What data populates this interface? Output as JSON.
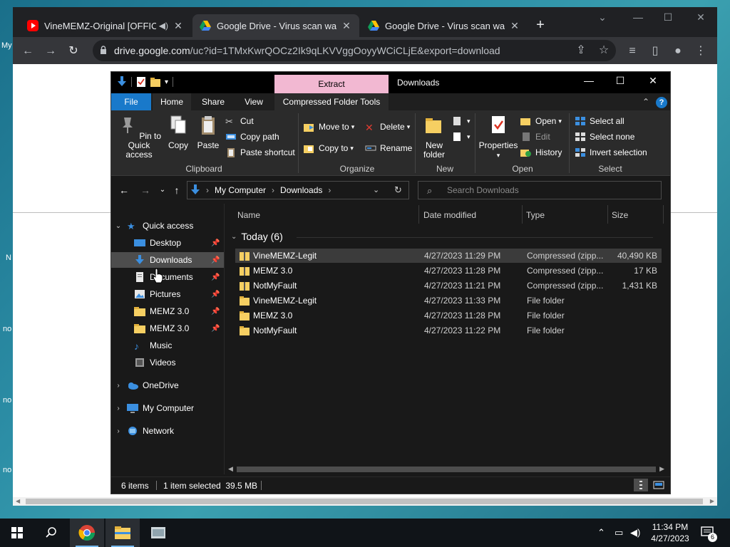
{
  "chrome": {
    "tabs": [
      {
        "title": "VineMEMZ-Original [OFFICIAL",
        "icon": "youtube-icon",
        "audio": true
      },
      {
        "title": "Google Drive - Virus scan warning",
        "icon": "google-drive-icon"
      },
      {
        "title": "Google Drive - Virus scan warning",
        "icon": "google-drive-icon"
      }
    ],
    "new_tab": "+",
    "url_host": "drive.google.com",
    "url_path": "/uc?id=1TMxKwrQOCz2Ik9qLKVVggOoyyWCiCLjE&export=download"
  },
  "desktop_edge_labels": [
    "My",
    "N",
    "no",
    "no",
    "no"
  ],
  "explorer": {
    "title": "Downloads",
    "contextual_tab": "Extract",
    "ribbon_tabs": [
      "File",
      "Home",
      "Share",
      "View",
      "Compressed Folder Tools"
    ],
    "clipboard": {
      "label": "Clipboard",
      "pin": "Pin to Quick access",
      "copy": "Copy",
      "paste": "Paste",
      "cut": "Cut",
      "copy_path": "Copy path",
      "paste_shortcut": "Paste shortcut"
    },
    "organize": {
      "label": "Organize",
      "move_to": "Move to",
      "copy_to": "Copy to",
      "delete": "Delete",
      "rename": "Rename"
    },
    "new": {
      "label": "New",
      "new_folder": "New folder"
    },
    "open": {
      "label": "Open",
      "properties": "Properties",
      "open": "Open",
      "edit": "Edit",
      "history": "History"
    },
    "select": {
      "label": "Select",
      "select_all": "Select all",
      "select_none": "Select none",
      "invert": "Invert selection"
    },
    "breadcrumb": [
      "My Computer",
      "Downloads"
    ],
    "search_placeholder": "Search Downloads",
    "nav": [
      {
        "label": "Quick access",
        "type": "root",
        "expanded": true
      },
      {
        "label": "Desktop",
        "pinned": true
      },
      {
        "label": "Downloads",
        "pinned": true,
        "selected": true
      },
      {
        "label": "Documents",
        "pinned": true
      },
      {
        "label": "Pictures",
        "pinned": true
      },
      {
        "label": "MEMZ 3.0",
        "pinned": true
      },
      {
        "label": "MEMZ 3.0",
        "pinned": true
      },
      {
        "label": "Music"
      },
      {
        "label": "Videos"
      },
      {
        "label": "OneDrive",
        "type": "root"
      },
      {
        "label": "My Computer",
        "type": "root"
      },
      {
        "label": "Network",
        "type": "root"
      }
    ],
    "columns": [
      "Name",
      "Date modified",
      "Type",
      "Size"
    ],
    "group": "Today (6)",
    "files": [
      {
        "name": "VineMEMZ-Legit",
        "date": "4/27/2023 11:29 PM",
        "type": "Compressed (zipp...",
        "size": "40,490 KB",
        "kind": "zip",
        "selected": true
      },
      {
        "name": "MEMZ 3.0",
        "date": "4/27/2023 11:28 PM",
        "type": "Compressed (zipp...",
        "size": "17 KB",
        "kind": "zip"
      },
      {
        "name": "NotMyFault",
        "date": "4/27/2023 11:21 PM",
        "type": "Compressed (zipp...",
        "size": "1,431 KB",
        "kind": "zip"
      },
      {
        "name": "VineMEMZ-Legit",
        "date": "4/27/2023 11:33 PM",
        "type": "File folder",
        "size": "",
        "kind": "folder"
      },
      {
        "name": "MEMZ 3.0",
        "date": "4/27/2023 11:28 PM",
        "type": "File folder",
        "size": "",
        "kind": "folder"
      },
      {
        "name": "NotMyFault",
        "date": "4/27/2023 11:22 PM",
        "type": "File folder",
        "size": "",
        "kind": "folder"
      }
    ],
    "status": {
      "items": "6 items",
      "selected": "1 item selected  39.5 MB"
    }
  },
  "taskbar": {
    "time": "11:34 PM",
    "date": "4/27/2023",
    "notifications": "6"
  }
}
